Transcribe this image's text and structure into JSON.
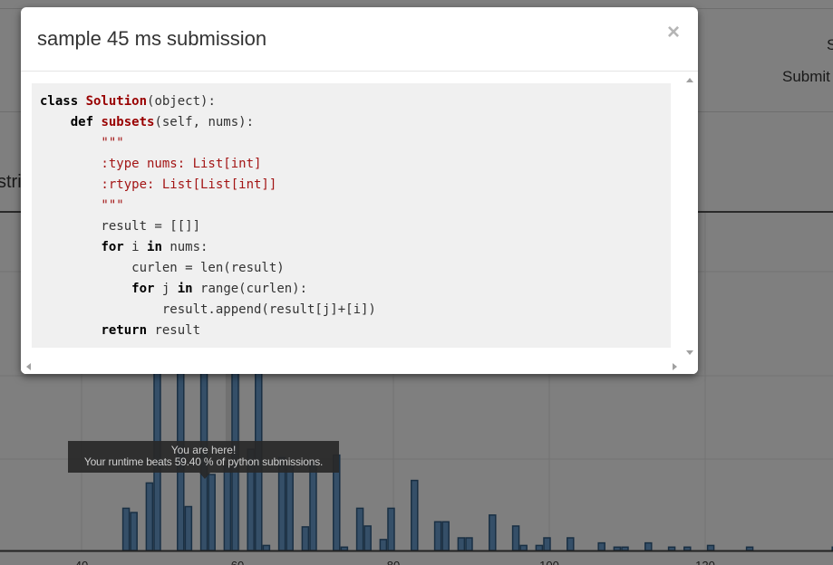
{
  "modal": {
    "title": "sample 45 ms submission",
    "close_label": "×",
    "code_lines": [
      [
        {
          "t": "class ",
          "c": "kw"
        },
        {
          "t": "Solution",
          "c": "cls"
        },
        {
          "t": "(object):",
          "c": ""
        }
      ],
      [
        {
          "t": "    ",
          "c": ""
        },
        {
          "t": "def ",
          "c": "kw"
        },
        {
          "t": "subsets",
          "c": "cls"
        },
        {
          "t": "(self, nums):",
          "c": ""
        }
      ],
      [
        {
          "t": "        \"\"\"",
          "c": "str"
        }
      ],
      [
        {
          "t": "        :type nums: List[int]",
          "c": "str"
        }
      ],
      [
        {
          "t": "        :rtype: List[List[int]]",
          "c": "str"
        }
      ],
      [
        {
          "t": "        \"\"\"",
          "c": "str"
        }
      ],
      [
        {
          "t": "        result = [[]]",
          "c": ""
        }
      ],
      [
        {
          "t": "        ",
          "c": ""
        },
        {
          "t": "for",
          "c": "kw"
        },
        {
          "t": " i ",
          "c": ""
        },
        {
          "t": "in",
          "c": "kw"
        },
        {
          "t": " nums:",
          "c": ""
        }
      ],
      [
        {
          "t": "            curlen = len(result)",
          "c": ""
        }
      ],
      [
        {
          "t": "            ",
          "c": ""
        },
        {
          "t": "for",
          "c": "kw"
        },
        {
          "t": " j ",
          "c": ""
        },
        {
          "t": "in",
          "c": "kw"
        },
        {
          "t": " range(curlen):",
          "c": ""
        }
      ],
      [
        {
          "t": "                result.append(result[j]+[i])",
          "c": ""
        }
      ],
      [
        {
          "t": "        ",
          "c": ""
        },
        {
          "t": "return",
          "c": "kw"
        },
        {
          "t": " result",
          "c": ""
        }
      ]
    ]
  },
  "background": {
    "partial_label_right_top": "S",
    "partial_label_submit": "Submit",
    "partial_label_left": "stri"
  },
  "tooltip": {
    "line1": "You are here!",
    "line2": "Your runtime beats 59.40 % of python submissions."
  },
  "colors": {
    "bar_fill": "#6a9ed0",
    "bar_stroke": "#335f87",
    "highlight_fill": "#b0b0b0"
  },
  "chart_data": {
    "type": "bar",
    "x_ticks": [
      40,
      60,
      80,
      100,
      120
    ],
    "x_range": [
      40,
      138
    ],
    "y_range": [
      0,
      40
    ],
    "highlight": {
      "x": 59.4
    },
    "bars": [
      {
        "x": 45.3,
        "y": 5
      },
      {
        "x": 46.3,
        "y": 4.5
      },
      {
        "x": 48.3,
        "y": 8
      },
      {
        "x": 49.3,
        "y": 26
      },
      {
        "x": 52.3,
        "y": 34
      },
      {
        "x": 53.3,
        "y": 5.2
      },
      {
        "x": 55.3,
        "y": 35
      },
      {
        "x": 56.3,
        "y": 9
      },
      {
        "x": 58.3,
        "y": 10
      },
      {
        "x": 59.3,
        "y": 37
      },
      {
        "x": 61.3,
        "y": 12
      },
      {
        "x": 62.3,
        "y": 29
      },
      {
        "x": 63.3,
        "y": 0.6
      },
      {
        "x": 65.3,
        "y": 11
      },
      {
        "x": 66.3,
        "y": 10
      },
      {
        "x": 68.3,
        "y": 2.8
      },
      {
        "x": 69.3,
        "y": 10.5
      },
      {
        "x": 72.3,
        "y": 11.3
      },
      {
        "x": 73.3,
        "y": 0.4
      },
      {
        "x": 75.3,
        "y": 5
      },
      {
        "x": 76.3,
        "y": 2.9
      },
      {
        "x": 78.3,
        "y": 1.3
      },
      {
        "x": 79.3,
        "y": 5
      },
      {
        "x": 82.3,
        "y": 8.3
      },
      {
        "x": 85.3,
        "y": 3.4
      },
      {
        "x": 86.3,
        "y": 3.4
      },
      {
        "x": 88.3,
        "y": 1.5
      },
      {
        "x": 89.3,
        "y": 1.5
      },
      {
        "x": 92.3,
        "y": 4.2
      },
      {
        "x": 95.3,
        "y": 2.9
      },
      {
        "x": 96.3,
        "y": 0.6
      },
      {
        "x": 98.3,
        "y": 0.6
      },
      {
        "x": 99.3,
        "y": 1.5
      },
      {
        "x": 102.3,
        "y": 1.5
      },
      {
        "x": 106.3,
        "y": 0.9
      },
      {
        "x": 108.3,
        "y": 0.4
      },
      {
        "x": 109.3,
        "y": 0.4
      },
      {
        "x": 112.3,
        "y": 0.9
      },
      {
        "x": 115.3,
        "y": 0.4
      },
      {
        "x": 117.3,
        "y": 0.4
      },
      {
        "x": 120.3,
        "y": 0.6
      },
      {
        "x": 125.3,
        "y": 0.4
      },
      {
        "x": 136.3,
        "y": 0.4
      }
    ]
  }
}
